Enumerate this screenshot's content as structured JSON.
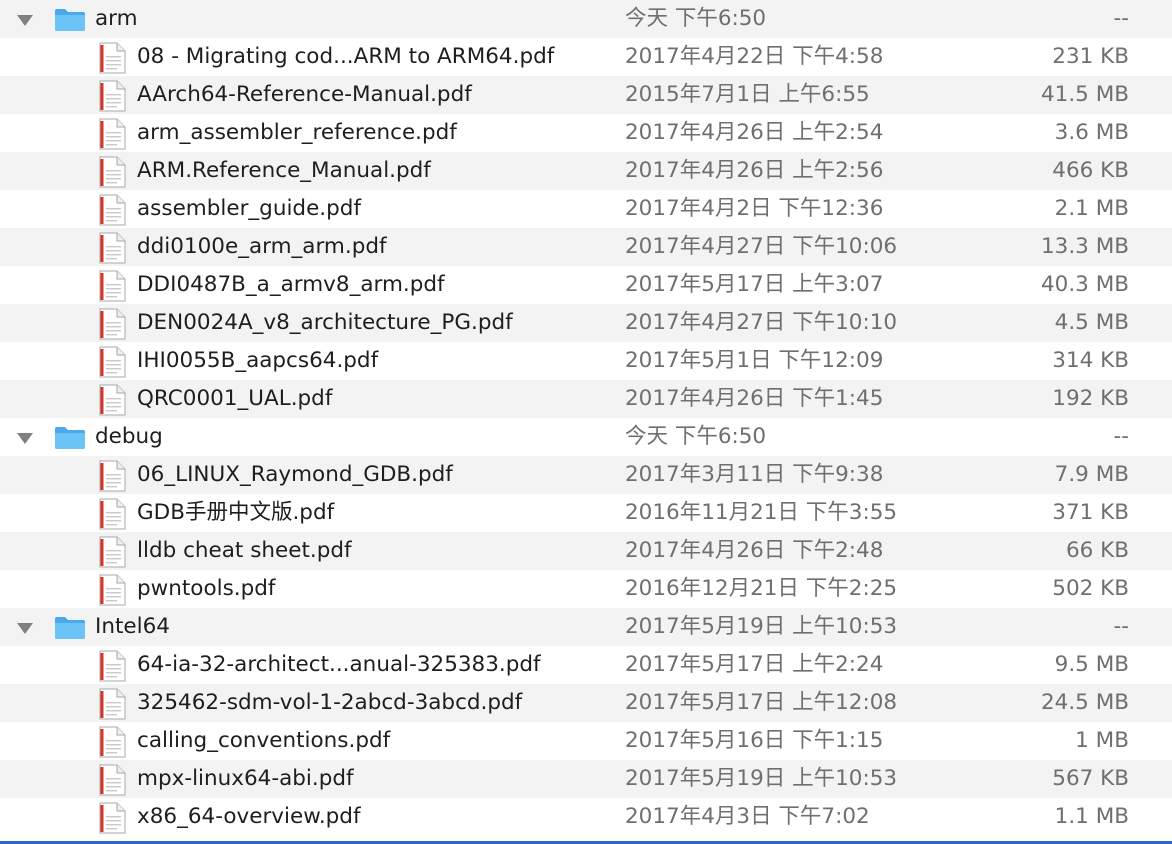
{
  "groups": [
    {
      "name": "arm",
      "date": "今天 下午6:50",
      "size": "--",
      "files": [
        {
          "name": "08 - Migrating cod...ARM to ARM64.pdf",
          "date": "2017年4月22日 下午4:58",
          "size": "231 KB"
        },
        {
          "name": "AArch64-Reference-Manual.pdf",
          "date": "2015年7月1日 上午6:55",
          "size": "41.5 MB"
        },
        {
          "name": "arm_assembler_reference.pdf",
          "date": "2017年4月26日 上午2:54",
          "size": "3.6 MB"
        },
        {
          "name": "ARM.Reference_Manual.pdf",
          "date": "2017年4月26日 上午2:56",
          "size": "466 KB"
        },
        {
          "name": "assembler_guide.pdf",
          "date": "2017年4月2日 下午12:36",
          "size": "2.1 MB"
        },
        {
          "name": "ddi0100e_arm_arm.pdf",
          "date": "2017年4月27日 下午10:06",
          "size": "13.3 MB"
        },
        {
          "name": "DDI0487B_a_armv8_arm.pdf",
          "date": "2017年5月17日 上午3:07",
          "size": "40.3 MB"
        },
        {
          "name": "DEN0024A_v8_architecture_PG.pdf",
          "date": "2017年4月27日 下午10:10",
          "size": "4.5 MB"
        },
        {
          "name": "IHI0055B_aapcs64.pdf",
          "date": "2017年5月1日 下午12:09",
          "size": "314 KB"
        },
        {
          "name": "QRC0001_UAL.pdf",
          "date": "2017年4月26日 下午1:45",
          "size": "192 KB"
        }
      ]
    },
    {
      "name": "debug",
      "date": "今天 下午6:50",
      "size": "--",
      "files": [
        {
          "name": "06_LINUX_Raymond_GDB.pdf",
          "date": "2017年3月11日 下午9:38",
          "size": "7.9 MB"
        },
        {
          "name": "GDB手册中文版.pdf",
          "date": "2016年11月21日 下午3:55",
          "size": "371 KB"
        },
        {
          "name": "lldb cheat sheet.pdf",
          "date": "2017年4月26日 下午2:48",
          "size": "66 KB"
        },
        {
          "name": "pwntools.pdf",
          "date": "2016年12月21日 下午2:25",
          "size": "502 KB"
        }
      ]
    },
    {
      "name": "Intel64",
      "date": "2017年5月19日 上午10:53",
      "size": "--",
      "files": [
        {
          "name": "64-ia-32-architect...anual-325383.pdf",
          "date": "2017年5月17日 上午2:24",
          "size": "9.5 MB"
        },
        {
          "name": "325462-sdm-vol-1-2abcd-3abcd.pdf",
          "date": "2017年5月17日 上午12:08",
          "size": "24.5 MB"
        },
        {
          "name": "calling_conventions.pdf",
          "date": "2017年5月16日 下午1:15",
          "size": "1 MB"
        },
        {
          "name": "mpx-linux64-abi.pdf",
          "date": "2017年5月19日 上午10:53",
          "size": "567 KB"
        },
        {
          "name": "x86_64-overview.pdf",
          "date": "2017年4月3日 下午7:02",
          "size": "1.1 MB"
        }
      ]
    }
  ],
  "icons": {
    "folder": "folder-icon",
    "file": "pdf-file-icon",
    "disclosure": "disclosure-triangle-expanded"
  },
  "colors": {
    "row_alt": "#f3f3f3",
    "folder_blue": "#5cb9f2",
    "pdf_red": "#d9342b",
    "secondary_text": "#6f6f6f",
    "selection_blue": "#2f67c9"
  }
}
